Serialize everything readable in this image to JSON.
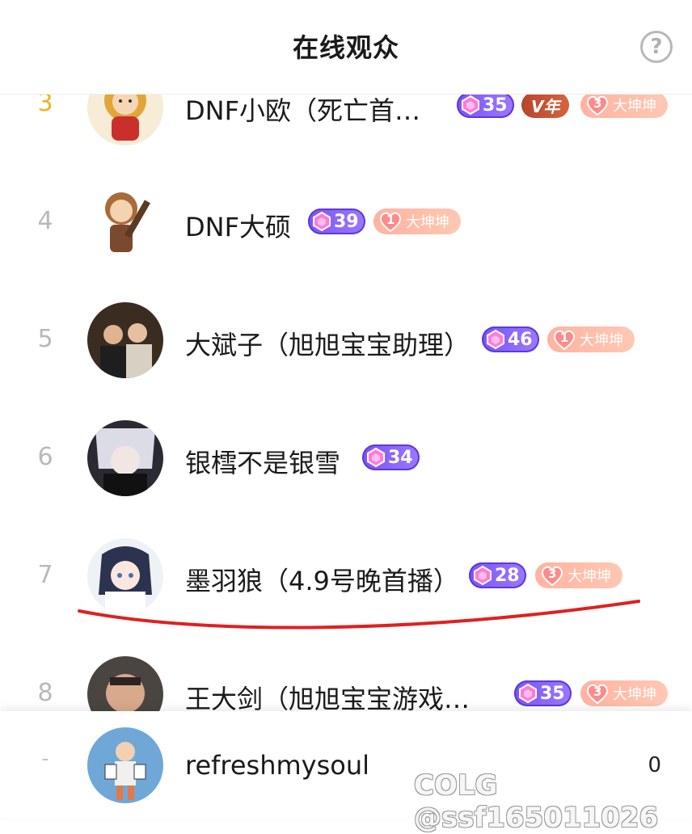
{
  "header": {
    "title": "在线观众",
    "help_label": "?"
  },
  "viewers": [
    {
      "rank": "3",
      "name": "DNF小欧（死亡首…",
      "level": "35",
      "year_badge": "V年",
      "fan_level": "3",
      "fan_label": "大坤坤",
      "avatar_icon": "cartoon-avatar-icon"
    },
    {
      "rank": "4",
      "name": "DNF大硕",
      "level": "39",
      "fan_level": "1",
      "fan_label": "大坤坤",
      "avatar_icon": "chibi-avatar-icon"
    },
    {
      "rank": "5",
      "name": "大斌子（旭旭宝宝助理）",
      "level": "46",
      "fan_level": "1",
      "fan_label": "大坤坤",
      "avatar_icon": "photo-avatar-icon"
    },
    {
      "rank": "6",
      "name": "银樰不是银雪",
      "level": "34",
      "avatar_icon": "anime-avatar-icon"
    },
    {
      "rank": "7",
      "name": "墨羽狼（4.9号晚首播）",
      "level": "28",
      "fan_level": "3",
      "fan_label": "大坤坤",
      "avatar_icon": "anime-girl-avatar-icon"
    },
    {
      "rank": "8",
      "name": "王大剑（旭旭宝宝游戏…",
      "level": "35",
      "fan_level": "3",
      "fan_label": "大坤坤",
      "avatar_icon": "photo-avatar-icon"
    }
  ],
  "self": {
    "rank": "-",
    "name": "refreshmysoul",
    "score": "0",
    "avatar_icon": "cartoon-avatar-icon"
  },
  "watermark": "COLG @ssf165011026",
  "colors": {
    "accent_gold": "#f0b21a",
    "level_purple": "#7b55f5",
    "fan_pink": "#ffb3a0",
    "annotation_red": "#e02020"
  }
}
